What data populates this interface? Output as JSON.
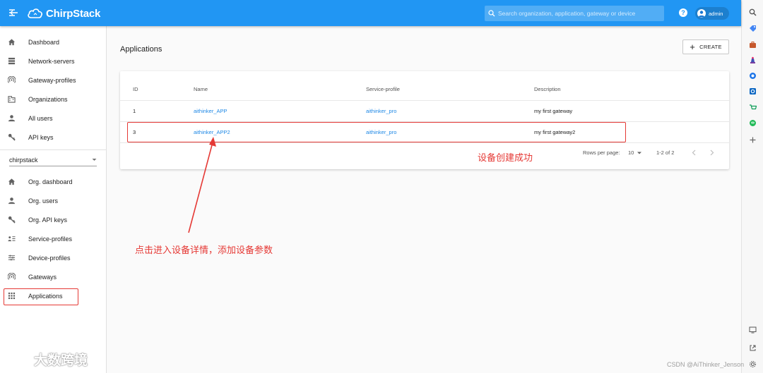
{
  "topbar": {
    "brand": "ChirpStack",
    "search_placeholder": "Search organization, application, gateway or device",
    "user": "admin",
    "help": "?"
  },
  "sidebar": {
    "global_items": [
      {
        "label": "Dashboard",
        "icon": "home-icon"
      },
      {
        "label": "Network-servers",
        "icon": "server-icon"
      },
      {
        "label": "Gateway-profiles",
        "icon": "signal-icon"
      },
      {
        "label": "Organizations",
        "icon": "building-icon"
      },
      {
        "label": "All users",
        "icon": "person-icon"
      },
      {
        "label": "API keys",
        "icon": "key-icon"
      }
    ],
    "org_select": "chirpstack",
    "org_items": [
      {
        "label": "Org. dashboard",
        "icon": "home-icon"
      },
      {
        "label": "Org. users",
        "icon": "person-icon"
      },
      {
        "label": "Org. API keys",
        "icon": "key-icon"
      },
      {
        "label": "Service-profiles",
        "icon": "list-icon"
      },
      {
        "label": "Device-profiles",
        "icon": "tune-icon"
      },
      {
        "label": "Gateways",
        "icon": "signal-icon"
      },
      {
        "label": "Applications",
        "icon": "apps-icon"
      }
    ]
  },
  "main": {
    "title": "Applications",
    "create_label": "CREATE",
    "table": {
      "headers": [
        "ID",
        "Name",
        "Service-profile",
        "Description"
      ],
      "rows": [
        [
          "1",
          "aithinker_APP",
          "aithinker_pro",
          "my first gateway"
        ],
        [
          "3",
          "aithinker_APP2",
          "aithinker_pro",
          "my first gateway2"
        ]
      ]
    },
    "pager": {
      "rows_per_page_label": "Rows per page:",
      "rows_per_page": "10",
      "range": "1-2 of 2"
    }
  },
  "annotations": {
    "created_note": "设备创建成功",
    "click_note": "点击进入设备详情，添加设备参数"
  },
  "watermarks": {
    "left": "大数跨境",
    "right": "CSDN @AiThinker_Jenson"
  },
  "colors": {
    "primary": "#2196f3",
    "link": "#1e88e5",
    "annotation": "#e53935"
  }
}
